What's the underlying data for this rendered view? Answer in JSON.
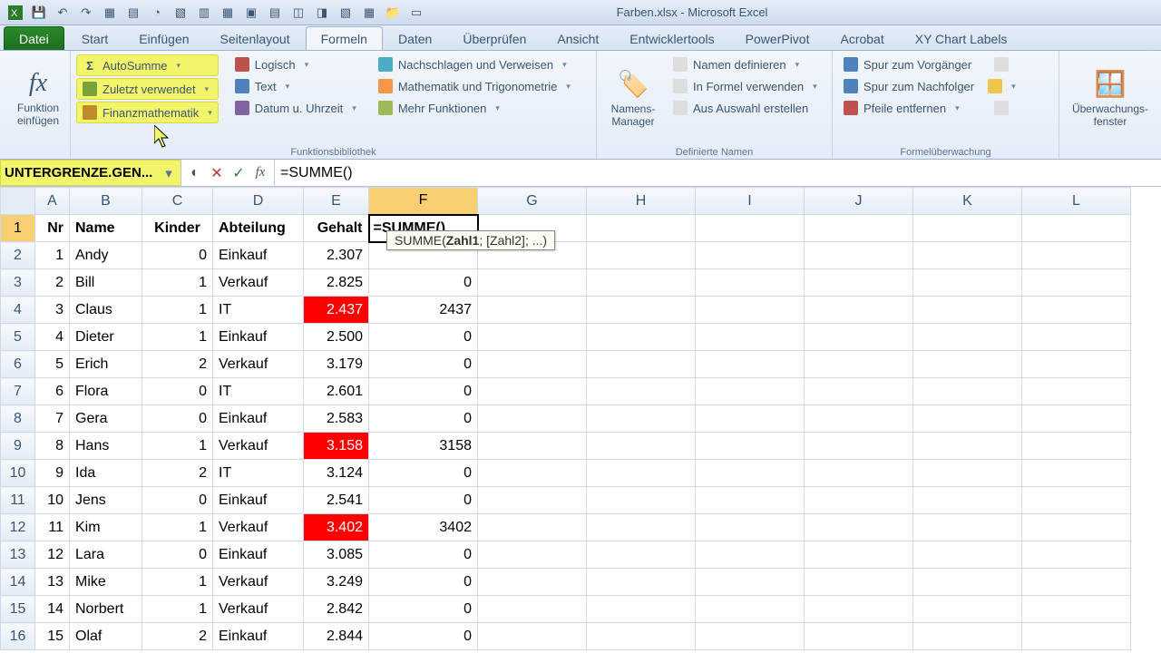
{
  "title": "Farben.xlsx - Microsoft Excel",
  "tabs": {
    "file": "Datei",
    "list": [
      "Start",
      "Einfügen",
      "Seitenlayout",
      "Formeln",
      "Daten",
      "Überprüfen",
      "Ansicht",
      "Entwicklertools",
      "PowerPivot",
      "Acrobat",
      "XY Chart Labels"
    ],
    "active": "Formeln"
  },
  "ribbon": {
    "insertFn": "Funktion einfügen",
    "lib": {
      "autosum": "AutoSumme",
      "recent": "Zuletzt verwendet",
      "financial": "Finanzmathematik",
      "logical": "Logisch",
      "text": "Text",
      "datetime": "Datum u. Uhrzeit",
      "lookup": "Nachschlagen und Verweisen",
      "math": "Mathematik und Trigonometrie",
      "more": "Mehr Funktionen",
      "label": "Funktionsbibliothek"
    },
    "names": {
      "manager": "Namens-Manager",
      "define": "Namen definieren",
      "use": "In Formel verwenden",
      "create": "Aus Auswahl erstellen",
      "label": "Definierte Namen"
    },
    "audit": {
      "tracePrec": "Spur zum Vorgänger",
      "traceDep": "Spur zum Nachfolger",
      "remove": "Pfeile entfernen",
      "watch": "Überwachungs-fenster",
      "label": "Formelüberwachung"
    }
  },
  "nameBox": "UNTERGRENZE.GEN...",
  "formula": "=SUMME()",
  "tooltip": {
    "fn": "SUMME(",
    "arg": "Zahl1",
    "rest": "; [Zahl2]; ...)"
  },
  "columns": [
    "A",
    "B",
    "C",
    "D",
    "E",
    "F",
    "G",
    "H",
    "I",
    "J",
    "K",
    "L"
  ],
  "headers": {
    "A": "Nr",
    "B": "Name",
    "C": "Kinder",
    "D": "Abteilung",
    "E": "Gehalt"
  },
  "activeCellText": "=SUMME()",
  "rows": [
    {
      "r": 2,
      "A": "1",
      "B": "Andy",
      "C": "0",
      "D": "Einkauf",
      "E": "2.307",
      "F": ""
    },
    {
      "r": 3,
      "A": "2",
      "B": "Bill",
      "C": "1",
      "D": "Verkauf",
      "E": "2.825",
      "F": "0"
    },
    {
      "r": 4,
      "A": "3",
      "B": "Claus",
      "C": "1",
      "D": "IT",
      "E": "2.437",
      "Ered": true,
      "F": "2437"
    },
    {
      "r": 5,
      "A": "4",
      "B": "Dieter",
      "C": "1",
      "D": "Einkauf",
      "E": "2.500",
      "F": "0"
    },
    {
      "r": 6,
      "A": "5",
      "B": "Erich",
      "C": "2",
      "D": "Verkauf",
      "E": "3.179",
      "F": "0"
    },
    {
      "r": 7,
      "A": "6",
      "B": "Flora",
      "C": "0",
      "D": "IT",
      "E": "2.601",
      "F": "0"
    },
    {
      "r": 8,
      "A": "7",
      "B": "Gera",
      "C": "0",
      "D": "Einkauf",
      "E": "2.583",
      "F": "0"
    },
    {
      "r": 9,
      "A": "8",
      "B": "Hans",
      "C": "1",
      "D": "Verkauf",
      "E": "3.158",
      "Ered": true,
      "F": "3158"
    },
    {
      "r": 10,
      "A": "9",
      "B": "Ida",
      "C": "2",
      "D": "IT",
      "E": "3.124",
      "F": "0"
    },
    {
      "r": 11,
      "A": "10",
      "B": "Jens",
      "C": "0",
      "D": "Einkauf",
      "E": "2.541",
      "F": "0"
    },
    {
      "r": 12,
      "A": "11",
      "B": "Kim",
      "C": "1",
      "D": "Verkauf",
      "E": "3.402",
      "Ered": true,
      "F": "3402"
    },
    {
      "r": 13,
      "A": "12",
      "B": "Lara",
      "C": "0",
      "D": "Einkauf",
      "E": "3.085",
      "F": "0"
    },
    {
      "r": 14,
      "A": "13",
      "B": "Mike",
      "C": "1",
      "D": "Verkauf",
      "E": "3.249",
      "F": "0"
    },
    {
      "r": 15,
      "A": "14",
      "B": "Norbert",
      "C": "1",
      "D": "Verkauf",
      "E": "2.842",
      "F": "0"
    },
    {
      "r": 16,
      "A": "15",
      "B": "Olaf",
      "C": "2",
      "D": "Einkauf",
      "E": "2.844",
      "F": "0"
    }
  ]
}
